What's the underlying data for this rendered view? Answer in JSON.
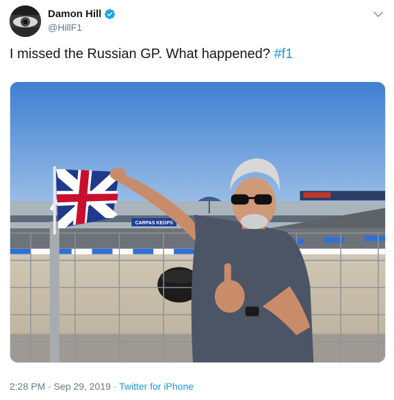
{
  "author": {
    "display_name": "Damon Hill",
    "handle": "@HillF1",
    "verified": true,
    "avatar_icon": "avatar-eye-photo"
  },
  "tweet": {
    "text": "I missed the Russian GP. What happened?",
    "hashtag": "#f1"
  },
  "media": {
    "description_icon": "photo",
    "banner_text": "CARPAS KEGPS"
  },
  "meta": {
    "time": "2:28 PM",
    "separator": "·",
    "date": "Sep 29, 2019",
    "source": "Twitter for iPhone"
  },
  "colors": {
    "link": "#1b95e0",
    "verified": "#1da1f2",
    "secondary_text": "#657786"
  }
}
